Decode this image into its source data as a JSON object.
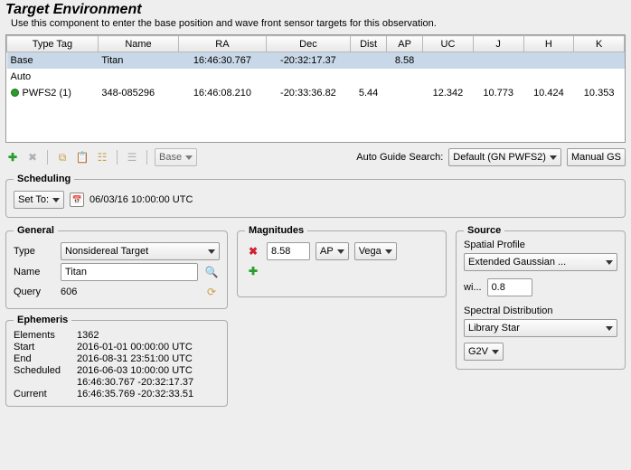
{
  "title": "Target Environment",
  "subtitle": "Use this component to enter the base position and wave front sensor targets for this observation.",
  "table": {
    "headers": [
      "Type Tag",
      "Name",
      "RA",
      "Dec",
      "Dist",
      "AP",
      "UC",
      "J",
      "H",
      "K"
    ],
    "baseRow": {
      "tag": "Base",
      "name": "Titan",
      "ra": "16:46:30.767",
      "dec": "-20:32:17.37",
      "dist": "",
      "ap": "8.58",
      "uc": "",
      "j": "",
      "h": "",
      "k": ""
    },
    "autoLabel": "Auto",
    "autoRow": {
      "tag": "PWFS2 (1)",
      "name": "348-085296",
      "ra": "16:46:08.210",
      "dec": "-20:33:36.82",
      "dist": "5.44",
      "ap": "",
      "uc": "12.342",
      "j": "10.773",
      "h": "10.424",
      "k": "10.353"
    }
  },
  "toolbar": {
    "baseCombo": "Base",
    "autoGuideLabel": "Auto Guide Search:",
    "autoGuideValue": "Default (GN PWFS2)",
    "manualBtn": "Manual GS"
  },
  "scheduling": {
    "legend": "Scheduling",
    "setTo": "Set To:",
    "datetime": "06/03/16 10:00:00 UTC"
  },
  "general": {
    "legend": "General",
    "typeLabel": "Type",
    "typeValue": "Nonsidereal Target",
    "nameLabel": "Name",
    "nameValue": "Titan",
    "queryLabel": "Query",
    "queryValue": "606"
  },
  "ephemeris": {
    "legend": "Ephemeris",
    "elementsLabel": "Elements",
    "elementsValue": "1362",
    "startLabel": "Start",
    "startValue": "2016-01-01 00:00:00 UTC",
    "endLabel": "End",
    "endValue": "2016-08-31 23:51:00 UTC",
    "schedLabel": "Scheduled",
    "schedValue": "2016-06-03 10:00:00 UTC",
    "schedCoords": "16:46:30.767 -20:32:17.37",
    "currentLabel": "Current",
    "currentValue": "16:46:35.769 -20:32:33.51"
  },
  "magnitudes": {
    "legend": "Magnitudes",
    "value": "8.58",
    "band": "AP",
    "system": "Vega"
  },
  "source": {
    "legend": "Source",
    "spatialLabel": "Spatial Profile",
    "spatialValue": "Extended Gaussian ...",
    "wiLabel": "wi...",
    "wiValue": "0.8",
    "spectralLabel": "Spectral Distribution",
    "spectralValue": "Library Star",
    "starType": "G2V"
  }
}
